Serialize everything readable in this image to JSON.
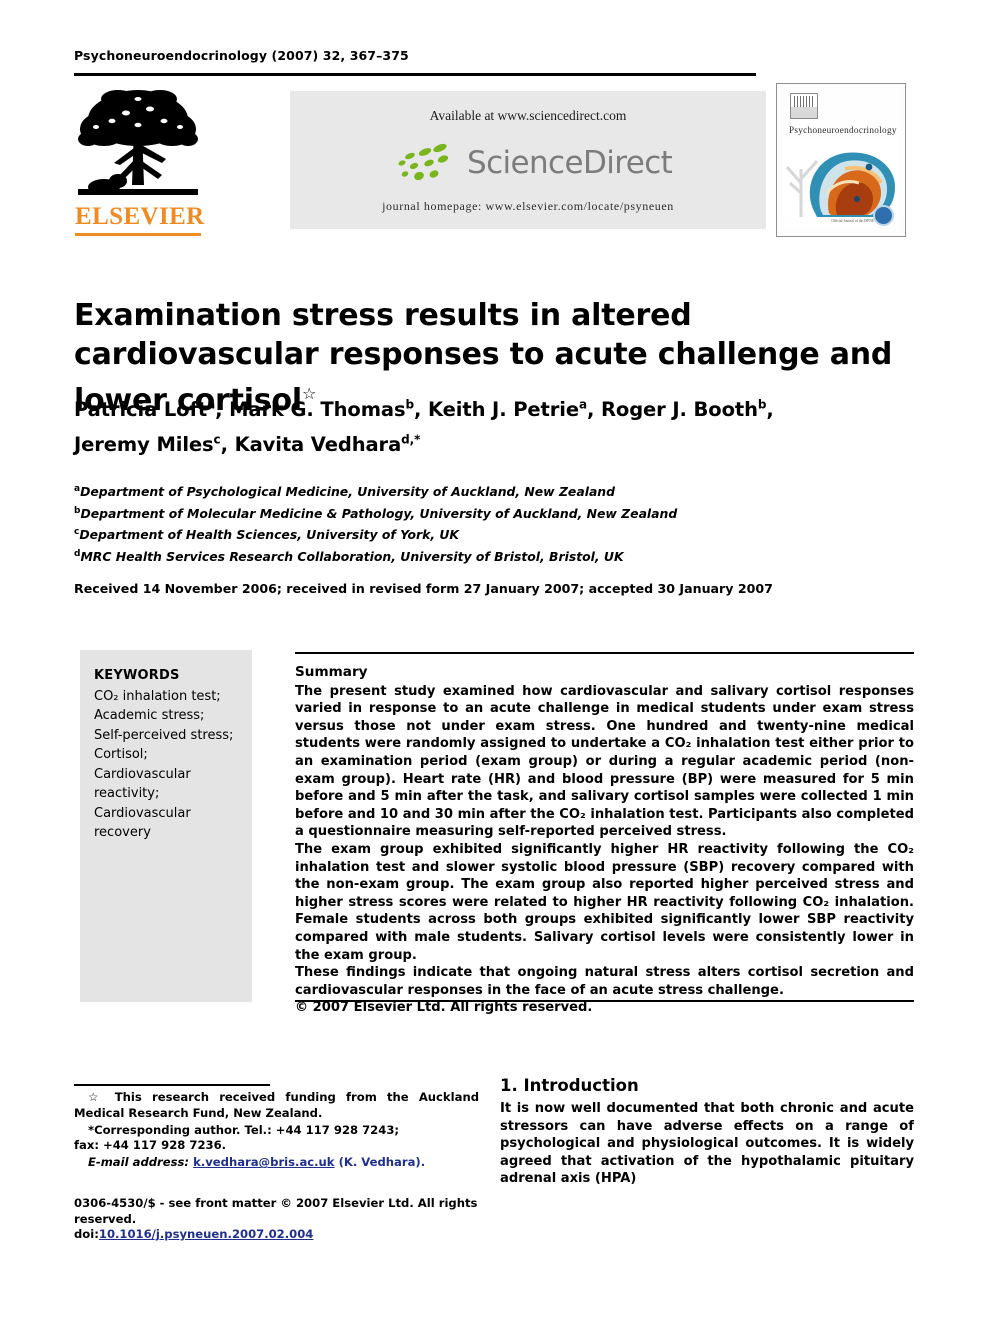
{
  "header": {
    "running_head": "Psychoneuroendocrinology (2007) 32, 367–375",
    "available_at": "Available at www.sciencedirect.com",
    "sciencedirect_wordmark": "ScienceDirect",
    "journal_homepage": "journal homepage: www.elsevier.com/locate/psyneuen",
    "publisher_wordmark": "ELSEVIER",
    "cover_title": "Psychoneuroendocrinology",
    "cover_badge_caption": "Official Journal of the ISPNE"
  },
  "article": {
    "title": "Examination stress results in altered cardiovascular responses to acute challenge and lower cortisol",
    "title_footnote_marker": "☆",
    "authors_line_1": "Patricia Loft",
    "authors": [
      {
        "name": "Patricia Loft",
        "sup": "a",
        "sep": ", "
      },
      {
        "name": "Mark G. Thomas",
        "sup": "b",
        "sep": ", "
      },
      {
        "name": "Keith J. Petrie",
        "sup": "a",
        "sep": ", "
      },
      {
        "name": "Roger J. Booth",
        "sup": "b",
        "sep": ","
      },
      {
        "name": "Jeremy Miles",
        "sup": "c",
        "sep": ", "
      },
      {
        "name": "Kavita Vedhara",
        "sup": "d,*",
        "sep": ""
      }
    ],
    "affiliations": [
      {
        "sup": "a",
        "text": "Department of Psychological Medicine, University of Auckland, New Zealand"
      },
      {
        "sup": "b",
        "text": "Department of Molecular Medicine & Pathology, University of Auckland, New Zealand"
      },
      {
        "sup": "c",
        "text": "Department of Health Sciences, University of York, UK"
      },
      {
        "sup": "d",
        "text": "MRC Health Services Research Collaboration, University of Bristol, Bristol, UK"
      }
    ],
    "history": "Received 14 November 2006; received in revised form 27 January 2007; accepted 30 January 2007"
  },
  "keywords": {
    "heading": "KEYWORDS",
    "items": [
      "CO₂ inhalation test;",
      "Academic stress;",
      "Self-perceived stress;",
      "Cortisol;",
      "Cardiovascular reactivity;",
      "Cardiovascular recovery"
    ]
  },
  "summary": {
    "heading": "Summary",
    "paragraph_1": "The present study examined how cardiovascular and salivary cortisol responses varied in response to an acute challenge in medical students under exam stress versus those not under exam stress. One hundred and twenty-nine medical students were randomly assigned to undertake a CO₂ inhalation test either prior to an examination period (exam group) or during a regular academic period (non-exam group). Heart rate (HR) and blood pressure (BP) were measured for 5 min before and 5 min after the task, and salivary cortisol samples were collected 1 min before and 10 and 30 min after the CO₂ inhalation test. Participants also completed a questionnaire measuring self-reported perceived stress.",
    "paragraph_2": "The exam group exhibited significantly higher HR reactivity following the CO₂ inhalation test and slower systolic blood pressure (SBP) recovery compared with the non-exam group. The exam group also reported higher perceived stress and higher stress scores were related to higher HR reactivity following CO₂ inhalation. Female students across both groups exhibited significantly lower SBP reactivity compared with male students. Salivary cortisol levels were consistently lower in the exam group.",
    "paragraph_3": "These findings indicate that ongoing natural stress alters cortisol secretion and cardiovascular responses in the face of an acute stress challenge.",
    "copyright": "© 2007 Elsevier Ltd. All rights reserved."
  },
  "footnotes": {
    "funding_marker": "☆",
    "funding": "This research received funding from the Auckland Medical Research Fund, New Zealand.",
    "corresponding_marker": "*",
    "corresponding": "Corresponding author. Tel.: +44 117 928 7243;",
    "fax": "fax: +44 117 928 7236.",
    "email_label": "E-mail address:",
    "email": "k.vedhara@bris.ac.uk",
    "email_suffix": "(K. Vedhara)."
  },
  "footer": {
    "front_matter": "0306-4530/$ - see front matter © 2007 Elsevier Ltd. All rights reserved.",
    "doi_label": "doi:",
    "doi": "10.1016/j.psyneuen.2007.02.004"
  },
  "introduction": {
    "heading": "1. Introduction",
    "paragraph_1": "It is now well documented that both chronic and acute stressors can have adverse effects on a range of psychological and physiological outcomes. It is widely agreed that activation of the hypothalamic pituitary adrenal axis (HPA)"
  },
  "colors": {
    "elsevier_orange": "#f08a22",
    "sciencedirect_green": "#7ab51d",
    "sciencedirect_gray": "#7c7c7c",
    "link_blue": "#1f2f8f",
    "band_gray": "#e8e8e8",
    "keyword_box_gray": "#e4e4e4"
  }
}
